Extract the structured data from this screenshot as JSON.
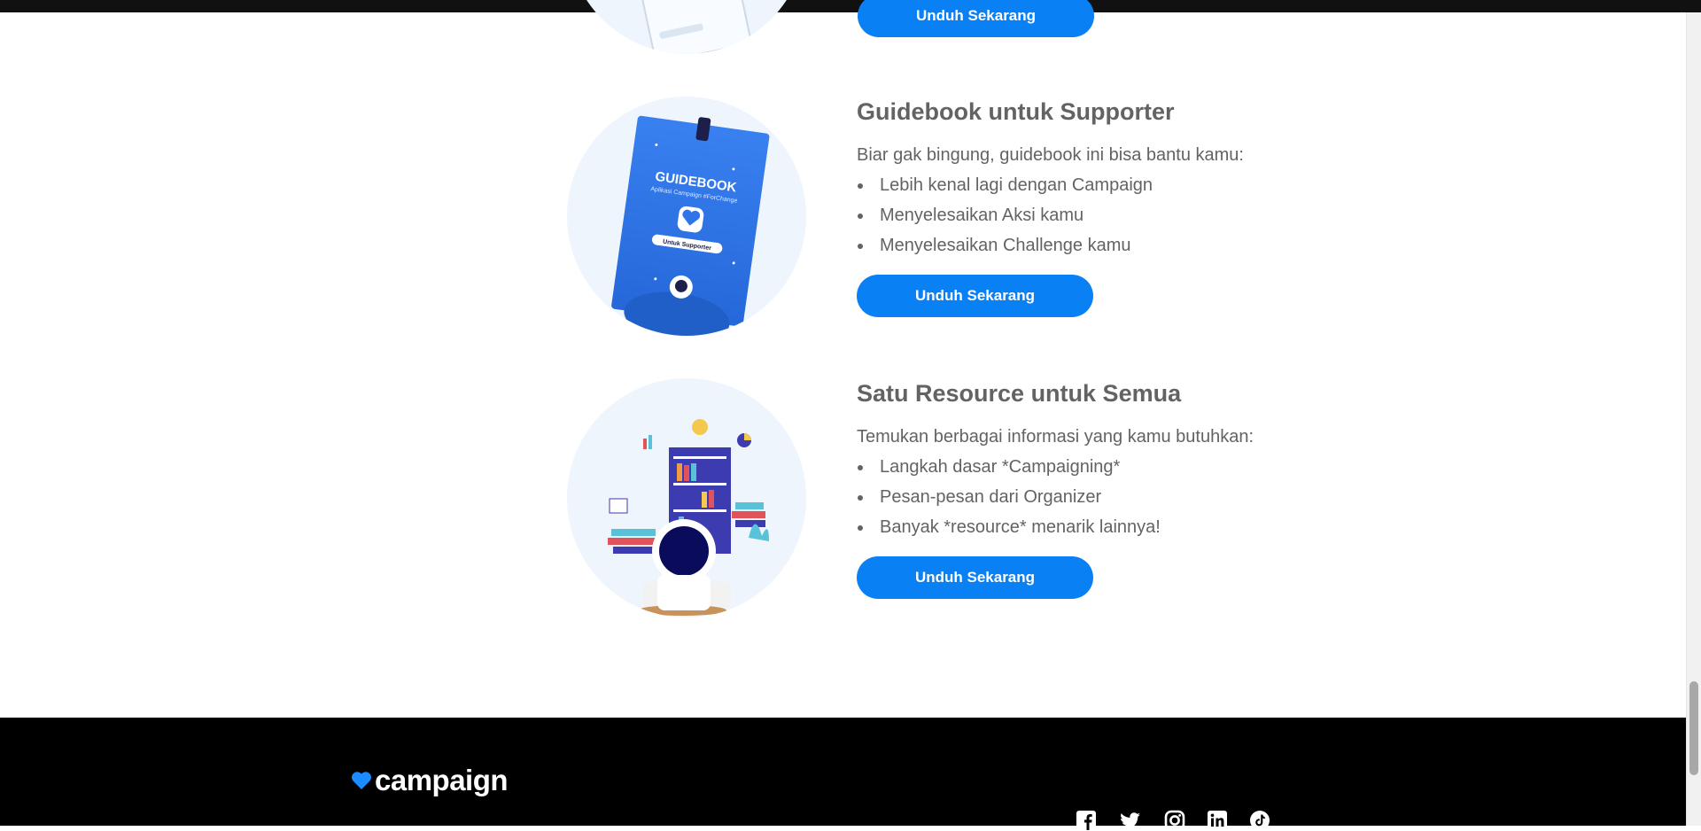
{
  "colors": {
    "button_bg": "#0a80f5",
    "text": "#636363",
    "circle_bg": "#eef5fd",
    "footer_bg": "#000000",
    "brand_heart": "#1a8cff"
  },
  "top_partial": {
    "button_label": "Unduh Sekarang"
  },
  "sections": [
    {
      "title": "Guidebook untuk Supporter",
      "description": "Biar gak bingung, guidebook ini bisa bantu kamu:",
      "items": [
        "Lebih kenal lagi dengan Campaign",
        "Menyelesaikan Aksi kamu",
        "Menyelesaikan Challenge kamu"
      ],
      "button_label": "Unduh Sekarang",
      "illustration": {
        "book_title": "GUIDEBOOK",
        "book_subtitle": "Aplikasi Campaign #ForChange",
        "book_label": "Untuk Supporter"
      }
    },
    {
      "title": "Satu Resource untuk Semua",
      "description": "Temukan berbagai informasi yang kamu butuhkan:",
      "items": [
        "Langkah dasar *Campaigning*",
        "Pesan-pesan dari Organizer",
        "Banyak *resource* menarik lainnya!"
      ],
      "button_label": "Unduh Sekarang"
    }
  ],
  "footer": {
    "logo_text": "campaign",
    "logo_icon": "heart-icon",
    "social_icons": [
      "facebook-icon",
      "twitter-icon",
      "instagram-icon",
      "linkedin-icon",
      "tiktok-icon"
    ]
  }
}
